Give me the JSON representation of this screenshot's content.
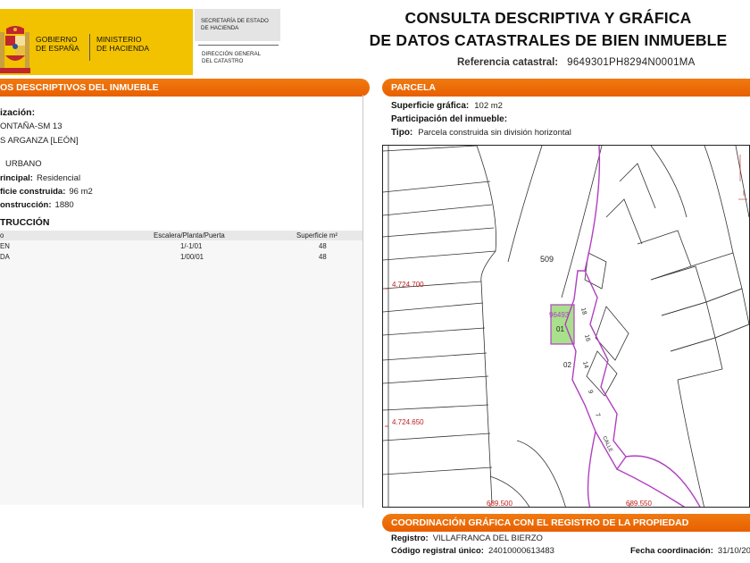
{
  "header": {
    "gov_line1": "GOBIERNO",
    "gov_line2": "DE ESPAÑA",
    "ministry_line1": "MINISTERIO",
    "ministry_line2": "DE HACIENDA",
    "sec_line1": "SECRETARÍA DE ESTADO",
    "sec_line2": "DE HACIENDA",
    "dir_line1": "DIRECCIÓN GENERAL",
    "dir_line2": "DEL CATASTRO",
    "title_line1": "CONSULTA DESCRIPTIVA Y GRÁFICA",
    "title_line2": "DE DATOS CATASTRALES DE BIEN INMUEBLE",
    "ref_label": "Referencia catastral:",
    "ref_value": "9649301PH8294N0001MA"
  },
  "left": {
    "section_title": "OS DESCRIPTIVOS DEL INMUEBLE",
    "location_label": "ización:",
    "address_line1": "ONTAÑA-SM 13",
    "address_line2": "S ARGANZA [LEÓN]",
    "class_value": "URBANO",
    "use_label": "rincipal:",
    "use_value": "Residencial",
    "area_label": "ficie construida:",
    "area_value": "96 m2",
    "year_label": "onstrucción:",
    "year_value": "1880",
    "construction_label": "TRUCCIÓN",
    "table": {
      "headers": [
        "o",
        "Escalera/Planta/Puerta",
        "Superficie m²"
      ],
      "rows": [
        [
          "EN",
          "1/-1/01",
          "48"
        ],
        [
          "DA",
          "1/00/01",
          "48"
        ]
      ]
    }
  },
  "right": {
    "section_title": "PARCELA",
    "surface_label": "Superficie gráfica:",
    "surface_value": "102 m2",
    "participation_label": "Participación del inmueble:",
    "type_label": "Tipo:",
    "type_value": "Parcela construida sin división horizontal",
    "map_labels": {
      "parcel_509": "509",
      "coord_y1": "4.724.700",
      "coord_y2": "4.724.650",
      "coord_x1": "689.500",
      "coord_x2": "689.550",
      "parcel_ref": "96493",
      "lbl_01": "01",
      "lbl_02": "02",
      "lbl_18": "18",
      "lbl_16": "16",
      "lbl_14": "14",
      "lbl_9": "9",
      "lbl_7": "7",
      "street": "CALLE"
    }
  },
  "bottom": {
    "section_title": "COORDINACIÓN GRÁFICA CON EL REGISTRO DE LA PROPIEDAD",
    "registry_label": "Registro:",
    "registry_value": "VILLAFRANCA DEL BIERZO",
    "code_label": "Código registral único:",
    "code_value": "24010000613483",
    "date_label": "Fecha coordinación:",
    "date_value": "31/10/20"
  },
  "colors": {
    "gov_yellow": "#f2c200",
    "section_orange": "#e85f00",
    "parcel_outline": "#b040c0",
    "parcel_fill": "#a8e08c",
    "coord_red": "#c02020"
  }
}
